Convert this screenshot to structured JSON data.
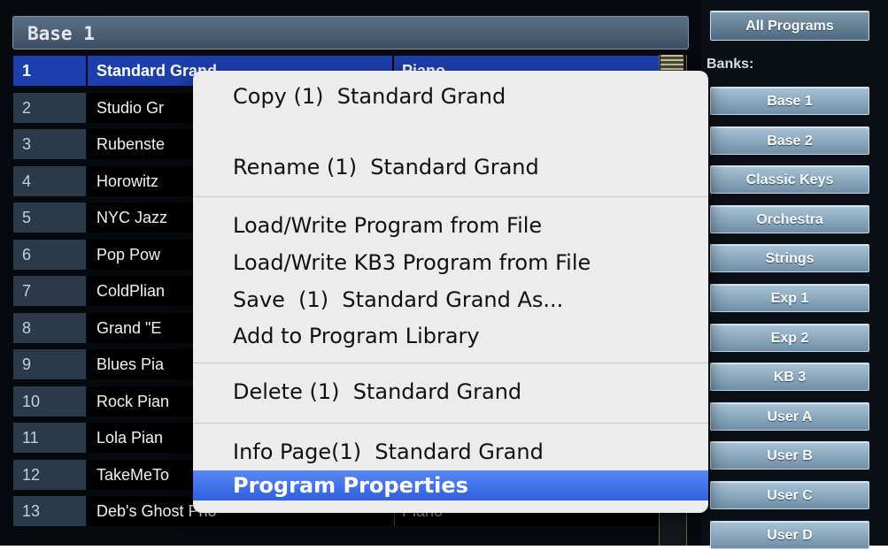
{
  "bank_header": {
    "title": "Base 1"
  },
  "programs": [
    {
      "num": "1",
      "name": "Standard Grand",
      "category": "Piano",
      "selected": true
    },
    {
      "num": "2",
      "name": "Studio Gr",
      "category": ""
    },
    {
      "num": "3",
      "name": "Rubenste",
      "category": ""
    },
    {
      "num": "4",
      "name": "Horowitz",
      "category": ""
    },
    {
      "num": "5",
      "name": "NYC Jazz",
      "category": ""
    },
    {
      "num": "6",
      "name": "Pop Pow",
      "category": ""
    },
    {
      "num": "7",
      "name": "ColdPlian",
      "category": ""
    },
    {
      "num": "8",
      "name": "Grand \"E",
      "category": ""
    },
    {
      "num": "9",
      "name": "Blues Pia",
      "category": ""
    },
    {
      "num": "10",
      "name": "Rock Pian",
      "category": ""
    },
    {
      "num": "11",
      "name": "Lola Pian",
      "category": ""
    },
    {
      "num": "12",
      "name": "TakeMeTo",
      "category": ""
    },
    {
      "num": "13",
      "name": "Deb's  Ghost Pno",
      "category": "Piano"
    }
  ],
  "right_panel": {
    "all_programs": "All Programs",
    "banks_label": "Banks:",
    "banks": [
      "Base 1",
      "Base 2",
      "Classic Keys",
      "Orchestra",
      "Strings",
      "Exp 1",
      "Exp 2",
      "KB 3",
      "User A",
      "User B",
      "User C",
      "User D"
    ]
  },
  "context_menu": {
    "copy": "Copy (1)  Standard Grand",
    "rename": "Rename (1)  Standard Grand",
    "load_write_program": "Load/Write Program from File",
    "load_write_kb3": "Load/Write KB3 Program from File",
    "save_as": "Save  (1)  Standard Grand As...",
    "add_library": "Add to Program Library",
    "delete": "Delete (1)  Standard Grand",
    "info_page": "Info Page(1)  Standard Grand",
    "program_properties": "Program Properties"
  }
}
